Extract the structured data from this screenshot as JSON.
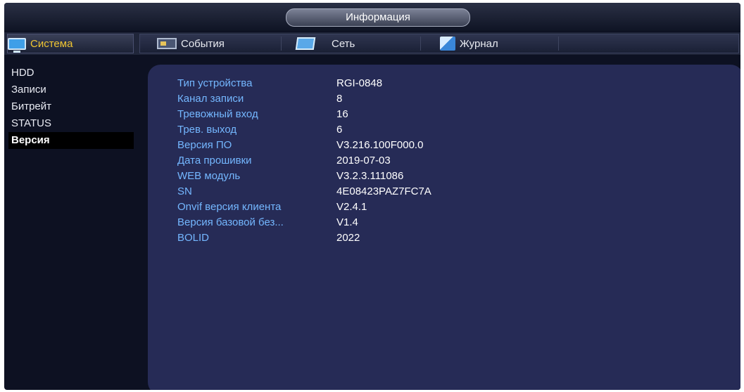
{
  "header": {
    "title": "Информация"
  },
  "tabs": {
    "active": {
      "label": "Система",
      "icon": "monitor-icon"
    },
    "others": [
      {
        "label": "События",
        "icon": "events-icon"
      },
      {
        "label": "Сеть",
        "icon": "network-icon"
      },
      {
        "label": "Журнал",
        "icon": "log-icon"
      }
    ]
  },
  "sidebar": {
    "items": [
      {
        "label": "HDD"
      },
      {
        "label": "Записи"
      },
      {
        "label": "Битрейт"
      },
      {
        "label": "STATUS"
      },
      {
        "label": "Версия",
        "active": true
      }
    ]
  },
  "info": {
    "rows": [
      {
        "key": "Тип устройства",
        "value": "RGI-0848"
      },
      {
        "key": "Канал записи",
        "value": "8"
      },
      {
        "key": "Тревожный вход",
        "value": "16"
      },
      {
        "key": "Трев. выход",
        "value": "6"
      },
      {
        "key": "Версия ПО",
        "value": "V3.216.100F000.0"
      },
      {
        "key": "Дата прошивки",
        "value": "2019-07-03"
      },
      {
        "key": "WEB модуль",
        "value": "V3.2.3.111086"
      },
      {
        "key": "SN",
        "value": "4E08423PAZ7FC7A"
      },
      {
        "key": "Onvif версия клиента",
        "value": "V2.4.1"
      },
      {
        "key": "Версия базовой без...",
        "value": "V1.4"
      },
      {
        "key": "BOLID",
        "value": "2022"
      }
    ]
  },
  "colors": {
    "accent": "#f0c531",
    "key_text": "#74b7ff",
    "panel": "#262b56"
  }
}
